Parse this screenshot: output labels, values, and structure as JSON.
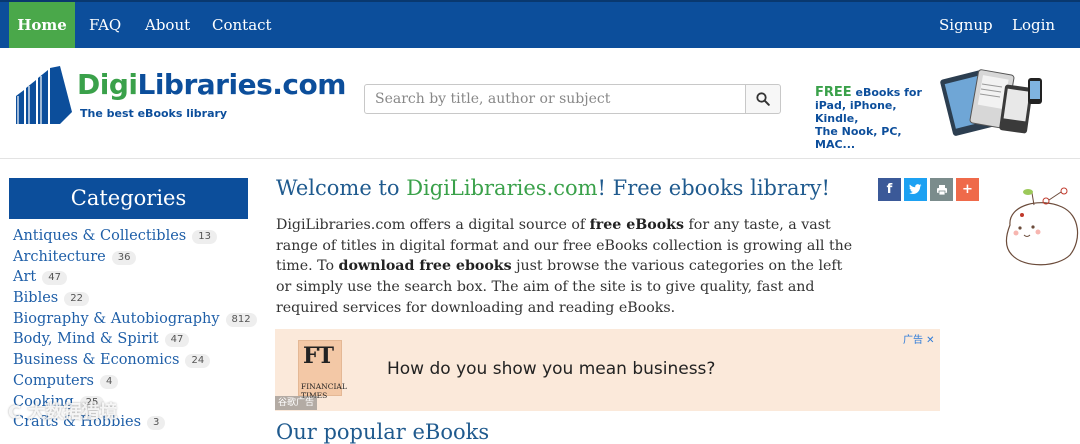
{
  "nav": {
    "home": "Home",
    "faq": "FAQ",
    "about": "About",
    "contact": "Contact",
    "signup": "Signup",
    "login": "Login"
  },
  "header": {
    "logo_part1": "Digi",
    "logo_part2": "Libraries.com",
    "tagline": "The best eBooks library",
    "search_placeholder": "Search by title, author or subject",
    "promo_free": "FREE",
    "promo_line1": " eBooks for",
    "promo_line2": "iPad, iPhone, Kindle,",
    "promo_line3": "The Nook, PC, MAC..."
  },
  "sidebar": {
    "title": "Categories",
    "items": [
      {
        "label": "Antiques & Collectibles",
        "count": "13"
      },
      {
        "label": "Architecture",
        "count": "36"
      },
      {
        "label": "Art",
        "count": "47"
      },
      {
        "label": "Bibles",
        "count": "22"
      },
      {
        "label": "Biography & Autobiography",
        "count": "812"
      },
      {
        "label": "Body, Mind & Spirit",
        "count": "47"
      },
      {
        "label": "Business & Economics",
        "count": "24"
      },
      {
        "label": "Computers",
        "count": "4"
      },
      {
        "label": "Cooking",
        "count": "25"
      },
      {
        "label": "Crafts & Hobbies",
        "count": "3"
      }
    ]
  },
  "main": {
    "title_prefix": "Welcome to ",
    "title_site": "DigiLibraries.com",
    "title_suffix": "! Free ebooks library!",
    "intro_1": "DigiLibraries.com offers a digital source of ",
    "intro_bold_1": "free eBooks",
    "intro_2": " for any taste, a vast range of titles in digital format and our free eBooks collection is growing all the time. To ",
    "intro_bold_2": "download free ebooks",
    "intro_3": " just browse the various categories on the left or simply use the search box. The aim of the site is to give quality, fast and required services for downloading and reading eBooks.",
    "next_heading": "Our popular eBooks"
  },
  "share": {
    "facebook": "f",
    "twitter": "t",
    "print": "p",
    "more": "+"
  },
  "ad": {
    "logo_ft": "FT",
    "logo_name": "FINANCIAL TIMES",
    "headline": "How do you show you mean business?",
    "flag": "广告 ✕",
    "label": "谷歌广告"
  },
  "watermark": "C 大数据猎境",
  "colors": {
    "nav_bg": "#0c4e9b",
    "home_active": "#4aa84a",
    "brand_green": "#3aa14a",
    "link_blue": "#1f5fa8",
    "facebook": "#3b5998",
    "twitter": "#1da1f2",
    "print": "#7b8c8c",
    "more": "#ef6a4a",
    "ad_bg": "#fbe9da"
  }
}
